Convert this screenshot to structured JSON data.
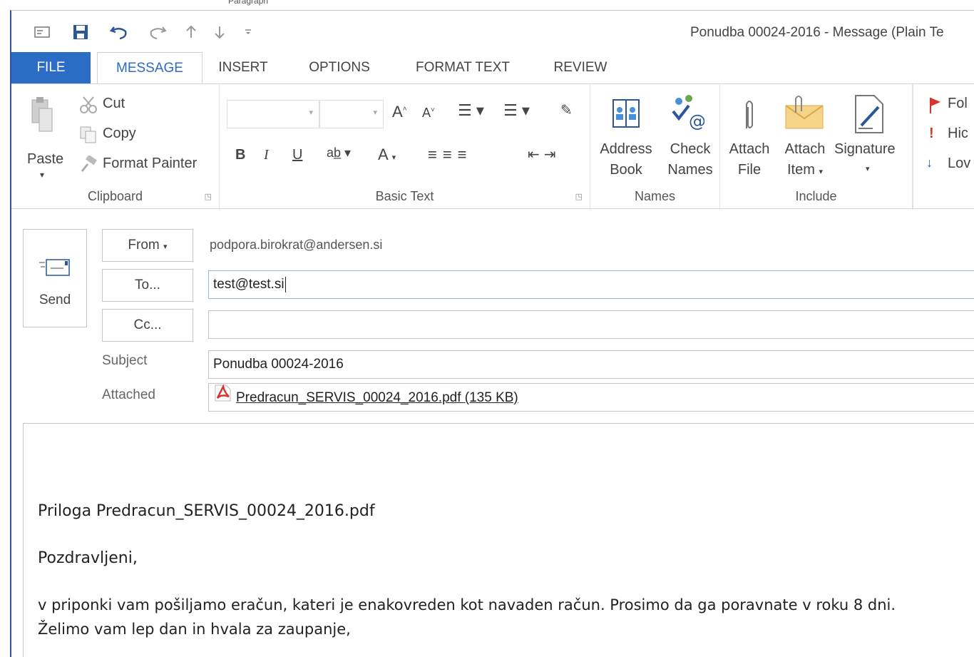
{
  "window_title": "Ponudba 00024-2016 - Message (Plain Te",
  "behind_window": {
    "partial_text": "Paragraph"
  },
  "quick_access": {
    "icons": [
      "message-icon",
      "save-icon",
      "undo-icon",
      "redo-icon",
      "up-arrow-icon",
      "down-arrow-icon",
      "customize-icon"
    ]
  },
  "tabs": {
    "file": "FILE",
    "message": "MESSAGE",
    "insert": "INSERT",
    "options": "OPTIONS",
    "format_text": "FORMAT TEXT",
    "review": "REVIEW"
  },
  "ribbon": {
    "clipboard": {
      "label": "Clipboard",
      "paste": "Paste",
      "cut": "Cut",
      "copy": "Copy",
      "format_painter": "Format Painter"
    },
    "basic_text": {
      "label": "Basic Text",
      "bold": "B",
      "italic": "I",
      "underline": "U",
      "font_color": "A"
    },
    "names": {
      "label": "Names",
      "address_line1": "Address",
      "address_line2": "Book",
      "check_line1": "Check",
      "check_line2": "Names"
    },
    "include": {
      "label": "Include",
      "attach_file_line1": "Attach",
      "attach_file_line2": "File",
      "attach_item_line1": "Attach",
      "attach_item_line2": "Item",
      "signature": "Signature"
    },
    "tags": {
      "follow_up": "Fol",
      "high": "Hic",
      "low": "Lov"
    }
  },
  "compose": {
    "send": "Send",
    "from_button": "From",
    "from_value": "podpora.birokrat@andersen.si",
    "to_button": "To...",
    "to_value": "test@test.si",
    "cc_button": "Cc...",
    "cc_value": "",
    "subject_label": "Subject",
    "subject_value": "Ponudba 00024-2016",
    "attached_label": "Attached",
    "attachment": "Predracun_SERVIS_00024_2016.pdf (135 KB)"
  },
  "body": {
    "line1": "Priloga Predracun_SERVIS_00024_2016.pdf",
    "line2": "Pozdravljeni,",
    "line3": "v priponki vam pošiljamo eračun, kateri je enakovreden kot navaden račun. Prosimo da ga poravnate v roku 8 dni.",
    "line4": "Želimo vam lep dan in hvala za zaupanje,"
  },
  "colors": {
    "accent": "#2b6cc4",
    "border": "#c6c6c6",
    "pdf_red": "#d9342b"
  }
}
